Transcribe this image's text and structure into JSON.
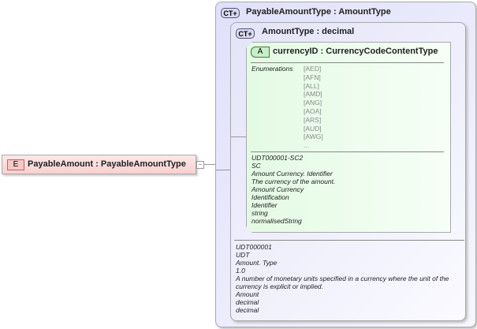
{
  "element": {
    "badge": "E",
    "title": "PayableAmount : PayableAmountType",
    "collapse": "−"
  },
  "outer_type": {
    "badge": "CT+",
    "title": "PayableAmountType : AmountType"
  },
  "inner_type": {
    "badge": "CT+",
    "title": "AmountType : decimal",
    "annotations": [
      "UDT000001",
      "UDT",
      "Amount. Type",
      "1.0",
      "A number of monetary units specified in a currency where the unit of the currency is explicit or implied.",
      "Amount",
      "decimal",
      "decimal"
    ]
  },
  "attribute": {
    "badge": "A",
    "title": "currencyID : CurrencyCodeContentType",
    "enum_label": "Enumerations",
    "enumerations": [
      "[AED]",
      "[AFN]",
      "[ALL]",
      "[AMD]",
      "[ANG]",
      "[AOA]",
      "[ARS]",
      "[AUD]",
      "[AWG]",
      "..."
    ],
    "annotations": [
      "UDT000001-SC2",
      "SC",
      "Amount Currency. Identifier",
      "The currency of the amount.",
      "Amount Currency",
      "Identification",
      "Identifier",
      "string",
      "normalisedString"
    ]
  }
}
